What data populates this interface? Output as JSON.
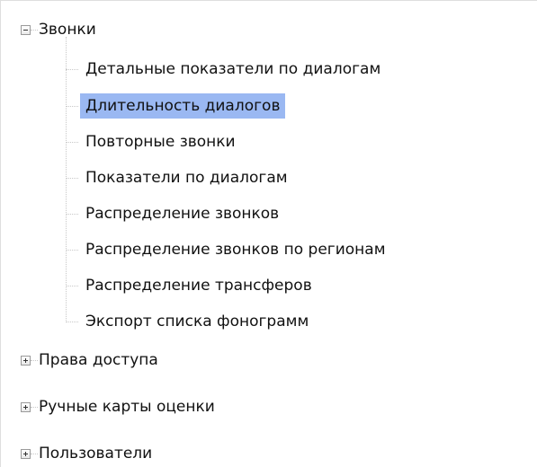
{
  "tree": {
    "calls": {
      "label": "Звонки",
      "expanded": true,
      "children": [
        "Детальные показатели по диалогам",
        "Длительность диалогов",
        "Повторные звонки",
        "Показатели по диалогам",
        "Распределение звонков",
        "Распределение звонков по регионам",
        "Распределение трансферов",
        "Экспорт списка фонограмм"
      ],
      "selected_child": "Длительность диалогов"
    },
    "access_rights": {
      "label": "Права доступа",
      "expanded": false
    },
    "manual_cards": {
      "label": "Ручные карты оценки",
      "expanded": false
    },
    "users": {
      "label": "Пользователи",
      "expanded": false
    }
  },
  "colors": {
    "selection": "#9ab8f2",
    "tree_lines": "#c8c8c8"
  },
  "icons": {
    "collapse": "minus-box-icon",
    "expand": "plus-box-icon"
  }
}
